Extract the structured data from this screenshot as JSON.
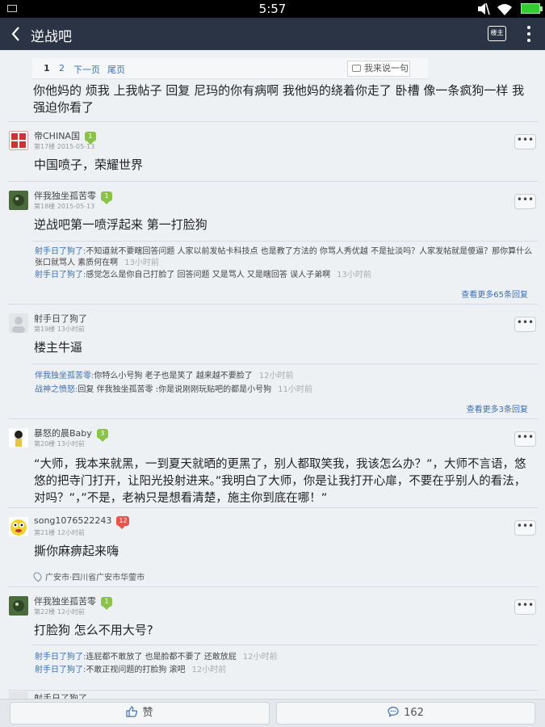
{
  "status_bar": {
    "time": "5:57"
  },
  "header": {
    "back_icon": "chevron-left-icon",
    "title": "逆战吧",
    "owner_label": "楼主",
    "more_icon": "vertical-dots-icon"
  },
  "embedded_image": {
    "page_1": "1",
    "page_2": "2",
    "next": "下一页",
    "last": "尾页",
    "reply_button": "我来说一句"
  },
  "top_text": "你他妈的 烦我 上我帖子 回复 尼玛的你有病啊 我他妈的绕着你走了 卧槽 像一条疯狗一样 我强迫你看了",
  "posts": [
    {
      "user": "帝CHINA国",
      "level": "1",
      "floor": "第17楼",
      "time": "2015-05-13",
      "content": "中国喷子，荣耀世界",
      "more": "•••"
    },
    {
      "user": "伴我独坐孤苦零",
      "level": "1",
      "floor": "第18楼",
      "time": "2015-05-13",
      "content": "逆战吧第一喷浮起来 第一打脸狗",
      "more": "•••",
      "replies": [
        {
          "user": "射手日了狗了:",
          "text": "不知道就不要瞎回答问题 人家以前发帖卡科技点 也是教了方法的 你骂人秀优越 不是扯淡吗？人家发帖就是傻逼？那你算什么 张口就骂人 素质何在啊",
          "time": "13小时前"
        },
        {
          "user": "射手日了狗了:",
          "text": "感觉怎么是你自己打脸了 回答问题 又是骂人 又是瞎回答 误人子弟啊",
          "time": "13小时前"
        }
      ],
      "see_more": "查看更多65条回复"
    },
    {
      "user": "射手日了狗了",
      "level": "",
      "floor": "第19楼",
      "time": "13小时前",
      "content": "楼主牛逼",
      "more": "•••",
      "replies": [
        {
          "user": "伴我独坐孤苦零:",
          "text": "你特么小号狗 老子也是笑了 越来越不要脸了",
          "time": "12小时前"
        },
        {
          "user": "战神之愤怒:",
          "text": "回复 伴我独坐孤苦零 :你是说刚刚玩贴吧的都是小号狗",
          "time": "11小时前"
        }
      ],
      "see_more": "查看更多3条回复"
    },
    {
      "user": "暴怒的晨Baby",
      "level": "3",
      "floor": "第20楼",
      "time": "13小时前",
      "content": "“大师，我本来就黑，一到夏天就晒的更黑了，别人都取笑我，我该怎么办？”，大师不言语，悠悠的把寺门打开，让阳光投射进来。”我明白了大师，你是让我打开心扉，不要在乎别人的看法，对吗？”，”不是，老衲只是想看清楚，施主你到底在哪！”",
      "more": "•••"
    },
    {
      "user": "song1076522243",
      "level": "12",
      "floor": "第21楼",
      "time": "12小时前",
      "content": "撕你麻痹起来嗨",
      "more": "•••",
      "location": "广安市·四川省广安市华蓥市"
    },
    {
      "user": "伴我独坐孤苦零",
      "level": "1",
      "floor": "第22楼",
      "time": "12小时前",
      "content": "打脸狗 怎么不用大号?",
      "more": "•••",
      "replies": [
        {
          "user": "射手日了狗了:",
          "text": "连屁都不敢放了 也是脸都不要了 还敢放屁",
          "time": "12小时前"
        },
        {
          "user": "射手日了狗了:",
          "text": "不敢正视问题的打脸狗 滚吧",
          "time": "12小时前"
        }
      ]
    },
    {
      "user": "射手日了狗了"
    }
  ],
  "bottom_bar": {
    "like_label": "赞",
    "like_icon": "thumbs-up-icon",
    "comment_count": "162",
    "comment_icon": "speech-bubble-icon"
  }
}
